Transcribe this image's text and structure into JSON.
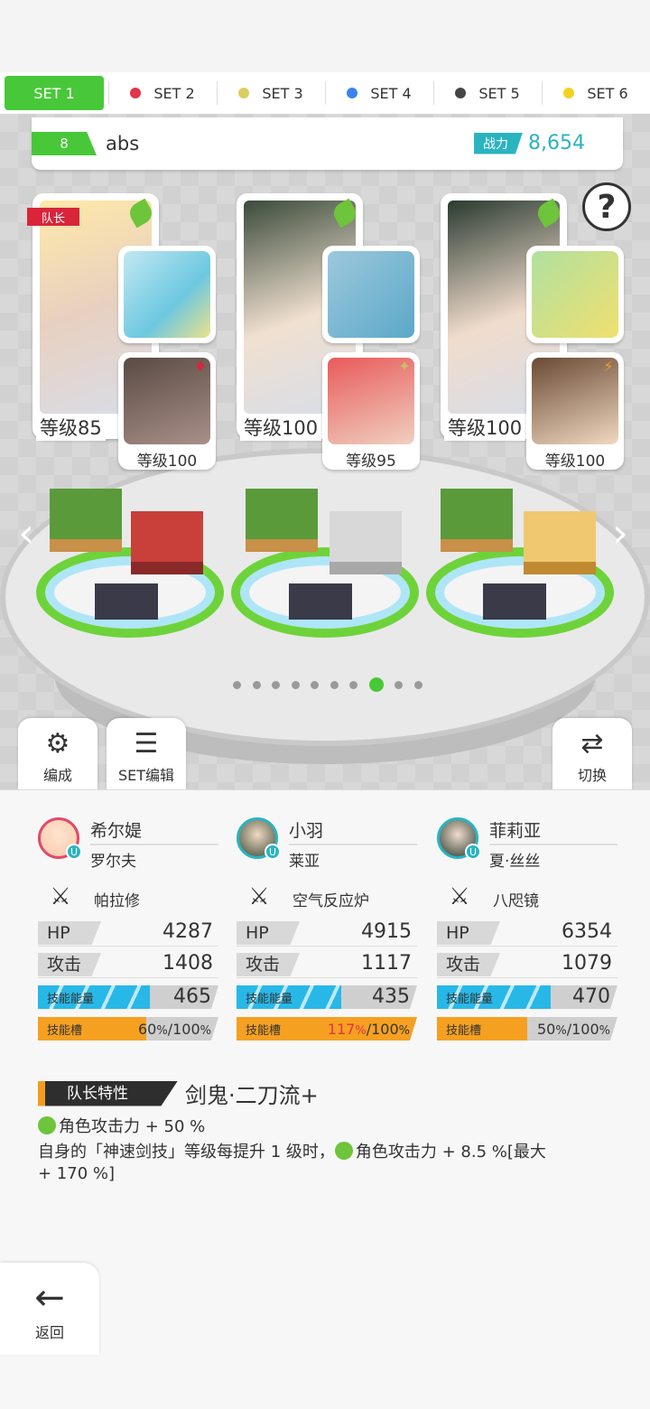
{
  "tabs": [
    {
      "label": "SET 1",
      "color": "#48c838",
      "active": true
    },
    {
      "label": "SET 2",
      "color": "#e2344a"
    },
    {
      "label": "SET 3",
      "color": "#d8cf5c"
    },
    {
      "label": "SET 4",
      "color": "#3b82f0"
    },
    {
      "label": "SET 5",
      "color": "#444444"
    },
    {
      "label": "SET 6",
      "color": "#f5d020"
    }
  ],
  "team": {
    "number": "8",
    "name": "abs",
    "power_label": "战力",
    "power_value": "8,654"
  },
  "help_icon": "question-icon",
  "heroes": [
    {
      "level": "等级85",
      "leader_badge": "队长",
      "sub_level": "等级100",
      "sub_attr": "♦"
    },
    {
      "level": "等级100",
      "sub_level": "等级95",
      "sub_attr": "✦"
    },
    {
      "level": "等级100",
      "sub_level": "等级100",
      "sub_attr": "⚡"
    }
  ],
  "pager": {
    "count": 10,
    "active": 7
  },
  "buttons": {
    "formation": "编成",
    "set_edit": "SET编辑",
    "switch": "切换"
  },
  "members": [
    {
      "name": "希尔媞",
      "partner": "罗尔夫",
      "weapon": "帕拉修",
      "hp": "4287",
      "atk": "1408",
      "energy": "465",
      "energy_fill": 0.62,
      "slot_text": "60",
      "slot_max": "/100",
      "slot_fill": 0.6
    },
    {
      "name": "小羽",
      "partner": "莱亚",
      "weapon": "空气反应炉",
      "hp": "4915",
      "atk": "1117",
      "energy": "435",
      "energy_fill": 0.58,
      "slot_text": "117",
      "slot_max": "/100",
      "slot_fill": 1.0
    },
    {
      "name": "菲莉亚",
      "partner": "夏·丝丝",
      "weapon": "八咫镜",
      "hp": "6354",
      "atk": "1079",
      "energy": "470",
      "energy_fill": 0.63,
      "slot_text": "50",
      "slot_max": "/100",
      "slot_fill": 0.5
    }
  ],
  "stat_labels": {
    "hp": "HP",
    "atk": "攻击",
    "energy": "技能能量",
    "slot": "技能槽",
    "percent": "%"
  },
  "leader": {
    "tag": "队长特性",
    "name": "剑鬼·二刀流+",
    "line1": "角色攻击力 + 50 %",
    "line2a": "自身的「神速剑技」等级每提升 1 级时，",
    "line2b": "角色攻击力 + 8.5 %[最大",
    "line3": "+ 170 %]"
  },
  "back_label": "返回",
  "colors": {
    "accent": "#48c838",
    "teal": "#2ab4c0",
    "energy": "#28b8e8",
    "slot": "#f5a020",
    "slot_over": "#e2344a"
  }
}
